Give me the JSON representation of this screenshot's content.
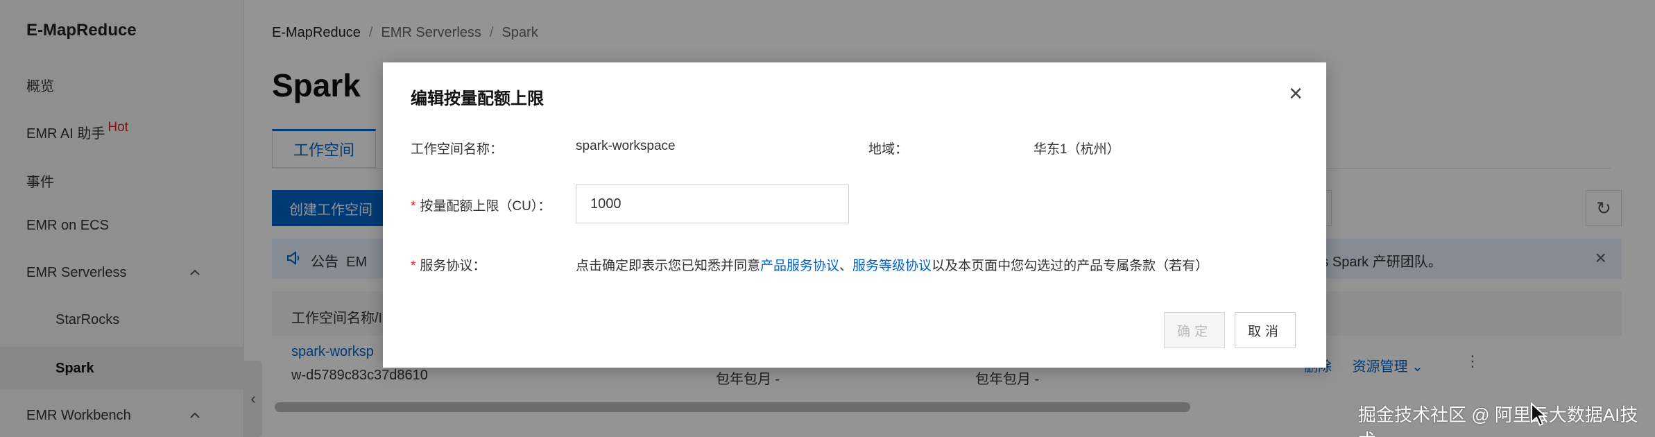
{
  "sidebar": {
    "brand": "E-MapReduce",
    "items": [
      {
        "label": "概览"
      },
      {
        "label": "EMR AI 助手",
        "badge": "Hot"
      },
      {
        "label": "事件"
      },
      {
        "label": "EMR on ECS"
      },
      {
        "label": "EMR Serverless"
      },
      {
        "label": "StarRocks"
      },
      {
        "label": "Spark"
      },
      {
        "label": "EMR Workbench"
      }
    ]
  },
  "breadcrumb": [
    "E-MapReduce",
    "EMR Serverless",
    "Spark"
  ],
  "page": {
    "title": "Spark",
    "tab": "工作空间",
    "create_button": "创建工作空间",
    "notice_label": "公告",
    "notice_prefix": "EM",
    "notice_tail": "erless Spark 产研团队。",
    "table_header": "工作空间名称/I",
    "row": {
      "name": "spark-worksp",
      "id": "w-d5789c83c37d8610",
      "pay1": "包年包月 -",
      "pay2": "包年包月 -",
      "action_delete": "删除",
      "action_resource": "资源管理"
    }
  },
  "modal": {
    "title": "编辑按量配额上限",
    "workspace_label": "工作空间名称：",
    "workspace_value": "spark-workspace",
    "region_label": "地域：",
    "region_value": "华东1（杭州）",
    "quota_label": "按量配额上限（CU）：",
    "quota_value": "1000",
    "agreement_label": "服务协议：",
    "agreement_prefix": "点击确定即表示您已知悉并同意",
    "agreement_link1": "产品服务协议",
    "agreement_sep": "、",
    "agreement_link2": "服务等级协议",
    "agreement_suffix": "以及本页面中您勾选过的产品专属条款（若有）",
    "ok_label": "确定",
    "cancel_label": "取消"
  },
  "watermark": "掘金技术社区 @ 阿里云大数据AI技术",
  "colors": {
    "accent": "#0064c8",
    "required": "#e02020",
    "notice_bg": "#e7f1fd"
  }
}
